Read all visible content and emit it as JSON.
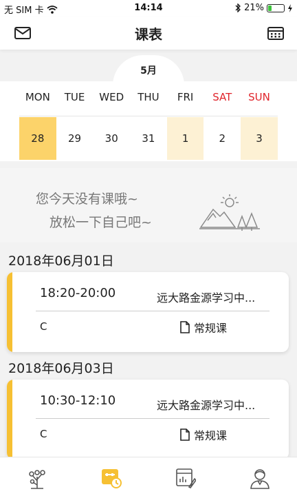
{
  "status_bar": {
    "carrier": "无 SIM 卡",
    "time": "14:14",
    "battery_percent": "21%",
    "battery_level": 0.21,
    "icons": [
      "wifi-icon",
      "bluetooth-icon",
      "battery-icon",
      "charging-icon"
    ]
  },
  "nav": {
    "title": "课表",
    "left_icon": "mail-icon",
    "right_icon": "calendar-icon"
  },
  "calendar": {
    "month": "5月",
    "weekdays": [
      "MON",
      "TUE",
      "WED",
      "THU",
      "FRI",
      "SAT",
      "SUN"
    ],
    "dates": [
      "28",
      "29",
      "30",
      "31",
      "1",
      "2",
      "3"
    ],
    "weekend_color": "#e0242b",
    "selected_color": "#fcd36a",
    "has_class_color": "#fdf1d4"
  },
  "empty_state": {
    "line1": "您今天没有课哦~",
    "line2": "放松一下自己吧~",
    "illustration": "mountain-sun-trees-icon"
  },
  "schedule": [
    {
      "date": "2018年06月01日",
      "time": "18:20-20:00",
      "location": "远大路金源学习中...",
      "code": "C",
      "type": "常规课"
    },
    {
      "date": "2018年06月03日",
      "time": "10:30-12:10",
      "location": "远大路金源学习中...",
      "code": "C",
      "type": "常规课"
    }
  ],
  "accent_color": "#f6c033",
  "tabbar": {
    "tabs": [
      "tree-icon",
      "schedule-icon",
      "report-icon",
      "profile-icon"
    ],
    "active_index": 1
  }
}
